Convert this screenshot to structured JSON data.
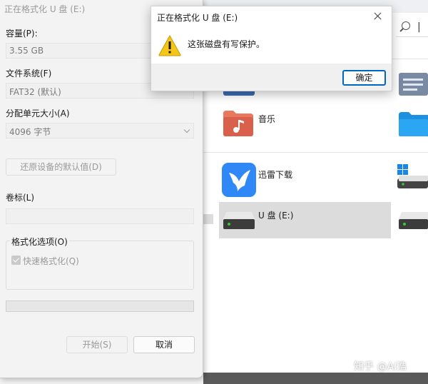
{
  "explorer": {
    "items": [
      {
        "label": "音乐"
      },
      {
        "label": "迅雷下载"
      },
      {
        "label": "U 盘 (E:)"
      }
    ]
  },
  "watermark": "知乎 @AI浩",
  "format_dialog": {
    "title": "正在格式化 U 盘 (E:)",
    "capacity_label": "容量(P):",
    "capacity_value": "3.55 GB",
    "filesystem_label": "文件系统(F)",
    "filesystem_value": "FAT32 (默认)",
    "alloc_label": "分配单元大小(A)",
    "alloc_value": "4096 字节",
    "restore_button": "还原设备的默认值(D)",
    "volume_label": "卷标(L)",
    "volume_value": "",
    "options_label": "格式化选项(O)",
    "quick_format_label": "快速格式化(Q)",
    "quick_format_checked": true,
    "progress": 0,
    "start_button": "开始(S)",
    "cancel_button": "取消"
  },
  "alert": {
    "title": "正在格式化 U 盘 (E:)",
    "message": "这张磁盘有写保护。",
    "ok_button": "确定",
    "icon": "warning-icon"
  },
  "colors": {
    "accent": "#0067c0",
    "warning": "#f5c518"
  }
}
